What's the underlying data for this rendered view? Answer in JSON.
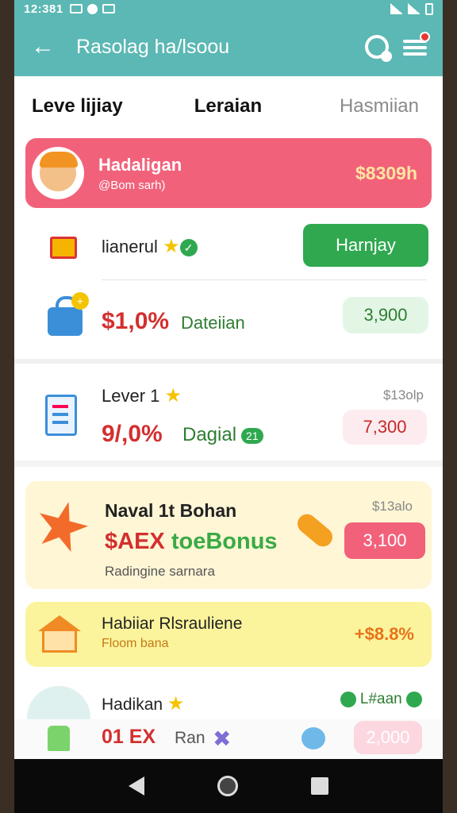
{
  "status_bar": {
    "time": "12:381"
  },
  "appbar": {
    "title": "Rasolag ha/lsoou"
  },
  "tabs": [
    "Leve lijiay",
    "Leraian",
    "Hasmiian"
  ],
  "banner": {
    "name": "Hadaligan",
    "sub": "@Bom sarh)",
    "amount": "$8309h"
  },
  "card1": {
    "title": "lianerul",
    "button": "Harnjay",
    "pct": "$1,0%",
    "pct_label": "Dateiian",
    "value": "3,900"
  },
  "card2": {
    "title": "Lever 1",
    "small": "$13olp",
    "pct": "9/,0%",
    "label": "Dagial",
    "tag": "21",
    "value": "7,300"
  },
  "card3": {
    "title": "Naval 1t Bohan",
    "small": "$13alo",
    "bonus_red": "$AEX ",
    "bonus_green": "toeBonus",
    "sub": "Radingine sarnara",
    "button": "3,100"
  },
  "card4": {
    "title": "Habiiar Rlsrauliene",
    "sub": "Floom bana",
    "amount": "+$8.8%"
  },
  "card5": {
    "title": "Hadikan",
    "link": "L#aan"
  },
  "bottom_strip": {
    "pct": "01 EX",
    "label": "Ran",
    "value": "2,000"
  }
}
